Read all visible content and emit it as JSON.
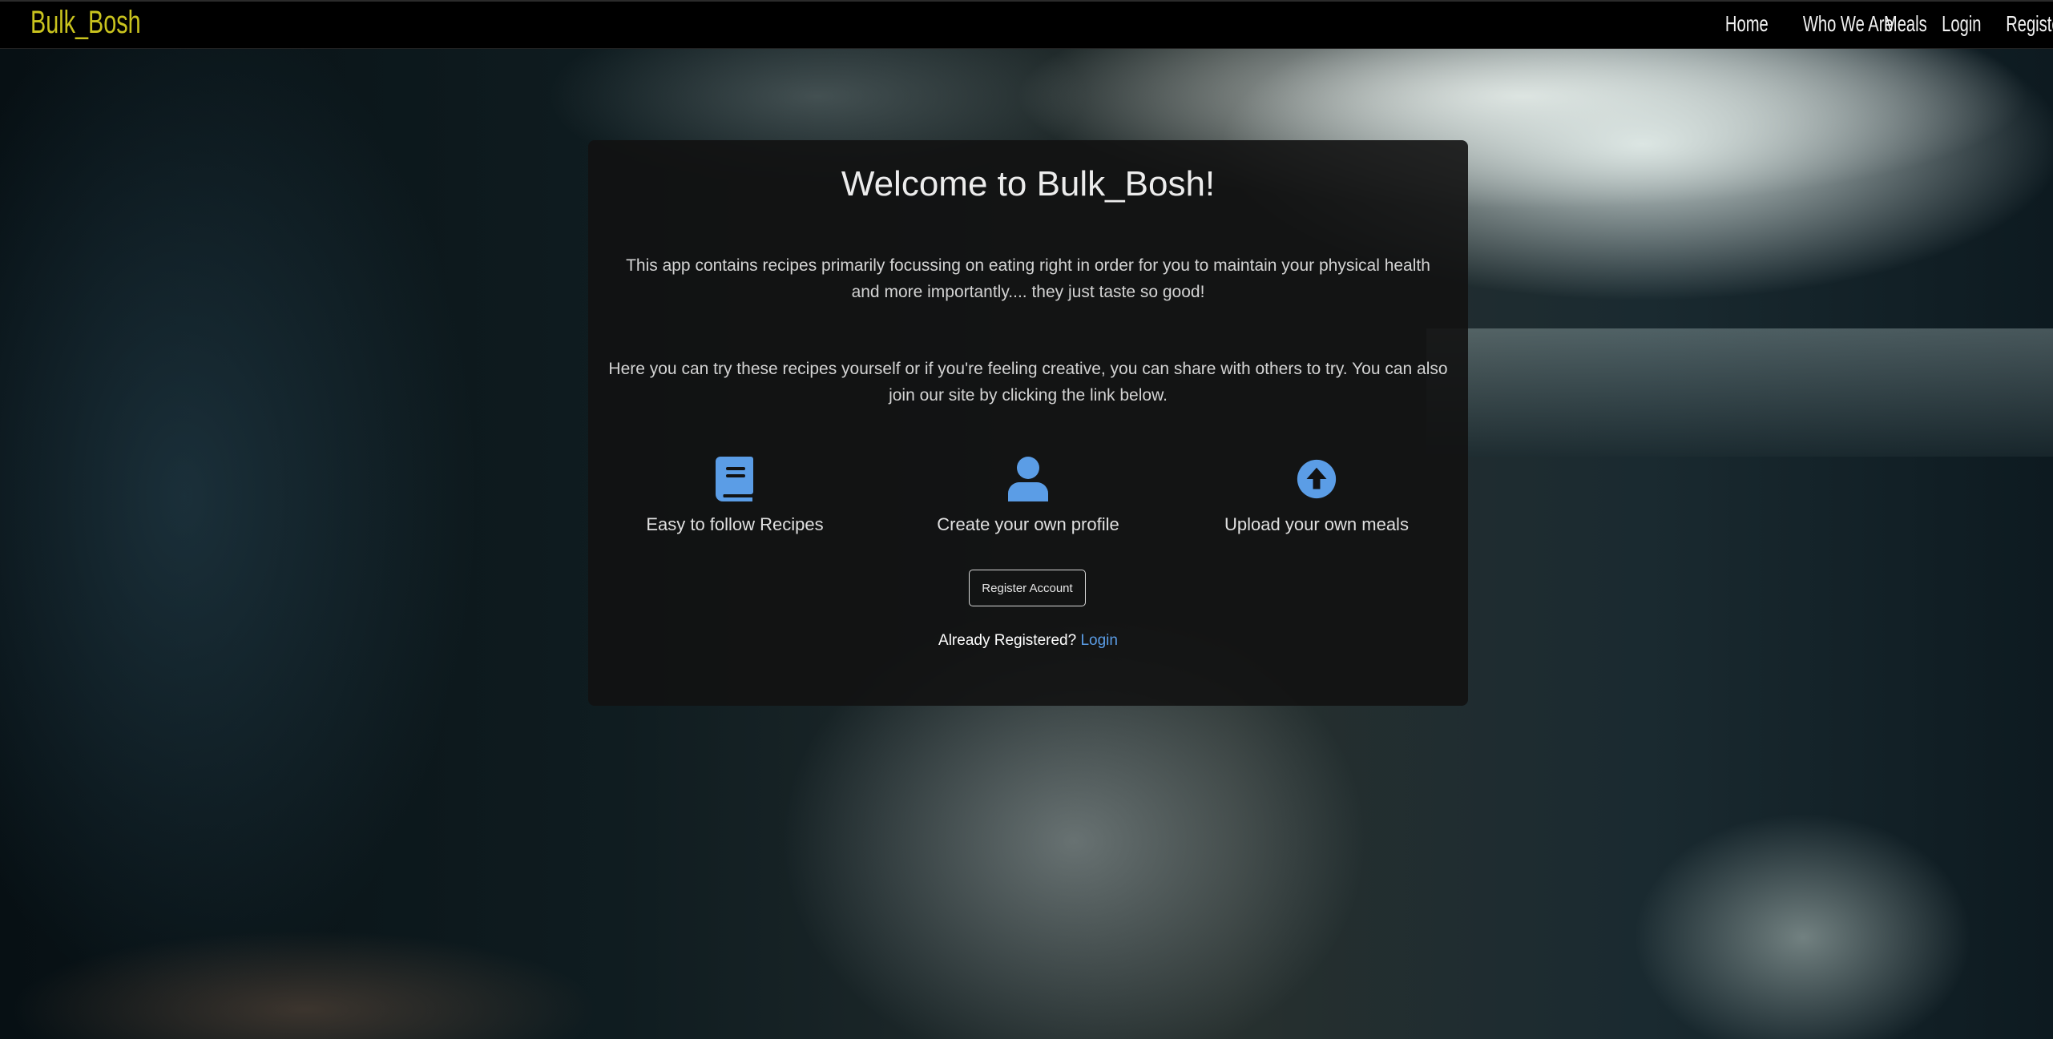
{
  "navbar": {
    "brand": "Bulk_Bosh",
    "links": [
      "Home",
      "Who We Are",
      "Meals",
      "Login",
      "Register"
    ]
  },
  "card": {
    "title": "Welcome to Bulk_Bosh!",
    "paragraph1": "This app contains recipes primarily focussing on eating right in order for you to maintain your physical health and more importantly.... they just taste so good!",
    "paragraph2": "Here you can try these recipes yourself or if you're feeling creative, you can share with others to try. You can also join our site by clicking the link below.",
    "features": [
      {
        "icon": "book-icon",
        "label": "Easy to follow Recipes"
      },
      {
        "icon": "user-icon",
        "label": "Create your own profile"
      },
      {
        "icon": "upload-icon",
        "label": "Upload your own meals"
      }
    ],
    "register_button": "Register Account",
    "already_text": "Already Registered?",
    "login_link": "Login"
  },
  "colors": {
    "brand": "#c9c31e",
    "icon": "#5b9de6",
    "link": "#5b9de6",
    "navbar_bg": "#000000"
  }
}
